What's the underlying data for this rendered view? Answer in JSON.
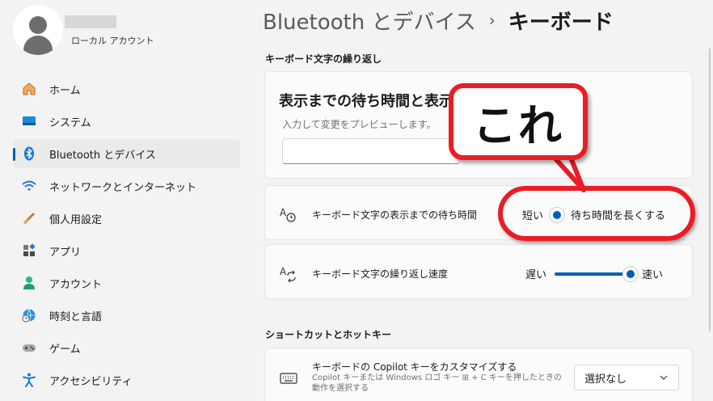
{
  "account": {
    "type_label": "ローカル アカウント"
  },
  "sidebar": {
    "items": [
      {
        "label": "ホーム",
        "icon": "home-icon"
      },
      {
        "label": "システム",
        "icon": "system-icon"
      },
      {
        "label": "Bluetooth とデバイス",
        "icon": "bluetooth-icon",
        "selected": true
      },
      {
        "label": "ネットワークとインターネット",
        "icon": "network-icon"
      },
      {
        "label": "個人用設定",
        "icon": "brush-icon"
      },
      {
        "label": "アプリ",
        "icon": "apps-icon"
      },
      {
        "label": "アカウント",
        "icon": "account-icon"
      },
      {
        "label": "時刻と言語",
        "icon": "time-language-icon"
      },
      {
        "label": "ゲーム",
        "icon": "gaming-icon"
      },
      {
        "label": "アクセシビリティ",
        "icon": "accessibility-icon"
      }
    ]
  },
  "breadcrumb": {
    "parent": "Bluetooth とデバイス",
    "separator": "›",
    "current": "キーボード"
  },
  "repeat_section": {
    "header": "キーボード文字の繰り返し",
    "test_card": {
      "title": "表示までの待ち時間と表示",
      "subtitle": "入力して変更をプレビューします。",
      "input_value": ""
    },
    "delay_row": {
      "label": "キーボード文字の表示までの待ち時間",
      "min_label": "短い",
      "max_label": "待ち時間を長くする",
      "value_fraction": 0.0
    },
    "rate_row": {
      "label": "キーボード文字の繰り返し速度",
      "min_label": "遅い",
      "max_label": "速い",
      "value_fraction": 1.0
    }
  },
  "shortcut_section": {
    "header": "ショートカットとホットキー",
    "copilot_row": {
      "label": "キーボードの Copilot キーをカスタマイズする",
      "description": "Copilot キーまたは Windows ロゴ キー ⊞ + C キーを押したときの動作を選択する",
      "dropdown_value": "選択なし"
    }
  },
  "annotation": {
    "text": "これ"
  },
  "colors": {
    "accent": "#005fb8",
    "annotation_red": "#ea1c24",
    "background": "#f3f3f3"
  }
}
